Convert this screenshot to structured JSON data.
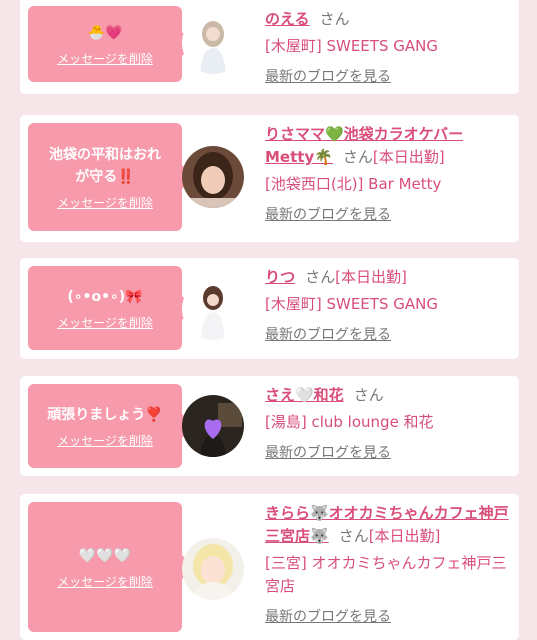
{
  "delete_label": "メッセージを削除",
  "san": "さん",
  "blog_label": "最新のブログを見る",
  "cards": [
    {
      "message": "🐣💗",
      "name": "のえる",
      "status": "",
      "shop": "[木屋町] SWEETS GANG"
    },
    {
      "message": "池袋の平和はおれ\nが守る‼️",
      "name": "りさママ💚池袋カラオケバーMetty🌴",
      "status": "[本日出勤]",
      "shop": "[池袋西口(北)] Bar Metty"
    },
    {
      "message": "(∘•o•∘)🎀",
      "name": "りつ",
      "status": "[本日出勤]",
      "shop": "[木屋町] SWEETS GANG"
    },
    {
      "message": "頑張りましょう❣️",
      "name": "さえ🤍和花",
      "status": "",
      "shop": "[湯島] club lounge 和花"
    },
    {
      "message": "🤍🤍🤍",
      "name": "きらら🐺オオカミちゃんカフェ神戸三宮店🐺",
      "status": "[本日出勤]",
      "shop": "[三宮] オオカミちゃんカフェ神戸三宮店"
    }
  ]
}
